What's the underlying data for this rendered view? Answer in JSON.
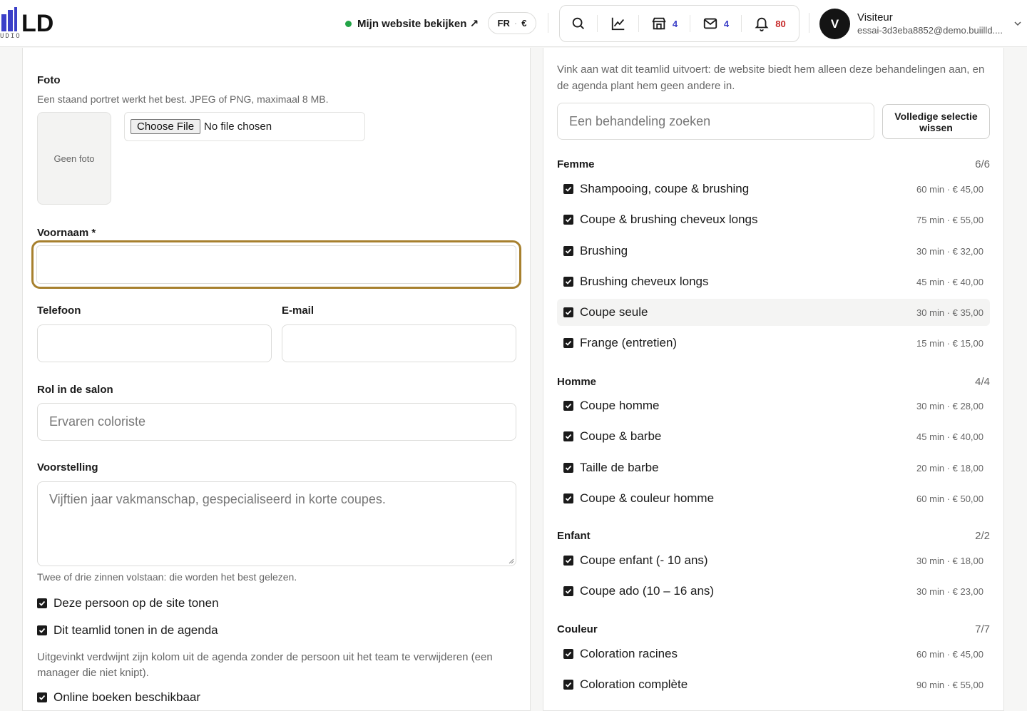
{
  "header": {
    "logo_text": "LD",
    "logo_sub": "UDIO",
    "view_site": "Mijn website bekijken ↗",
    "lang": "FR",
    "currency": "€",
    "counts": {
      "shop": "4",
      "mail": "4",
      "bell": "80"
    },
    "user": {
      "initial": "V",
      "name": "Visiteur",
      "email": "essai-3d3eba8852@demo.buiilld...."
    }
  },
  "form": {
    "photo_label": "Foto",
    "photo_hint": "Een staand portret werkt het best. JPEG of PNG, maximaal 8 MB.",
    "no_photo": "Geen foto",
    "file_button": "Choose File",
    "file_status": "No file chosen",
    "firstname_label": "Voornaam *",
    "firstname_value": "",
    "phone_label": "Telefoon",
    "email_label": "E-mail",
    "role_label": "Rol in de salon",
    "role_placeholder": "Ervaren coloriste",
    "bio_label": "Voorstelling",
    "bio_placeholder": "Vijftien jaar vakmanschap, gespecialiseerd in korte coupes.",
    "bio_hint": "Twee of drie zinnen volstaan: die worden het best gelezen.",
    "show_on_site": "Deze persoon op de site tonen",
    "show_in_agenda": "Dit teamlid tonen in de agenda",
    "agenda_hint": "Uitgevinkt verdwijnt zijn kolom uit de agenda zonder de persoon uit het team te verwijderen (een manager die niet knipt).",
    "online_booking": "Online boeken beschikbaar"
  },
  "services": {
    "intro": "Vink aan wat dit teamlid uitvoert: de website biedt hem alleen deze behandelingen aan, en de agenda plant hem geen andere in.",
    "search_placeholder": "Een behandeling zoeken",
    "clear_button": "Volledige selectie wissen",
    "categories": [
      {
        "name": "Femme",
        "count": "6/6",
        "items": [
          {
            "name": "Shampooing, coupe & brushing",
            "meta": "60 min · € 45,00"
          },
          {
            "name": "Coupe & brushing cheveux longs",
            "meta": "75 min · € 55,00"
          },
          {
            "name": "Brushing",
            "meta": "30 min · € 32,00"
          },
          {
            "name": "Brushing cheveux longs",
            "meta": "45 min · € 40,00"
          },
          {
            "name": "Coupe seule",
            "meta": "30 min · € 35,00"
          },
          {
            "name": "Frange (entretien)",
            "meta": "15 min · € 15,00"
          }
        ]
      },
      {
        "name": "Homme",
        "count": "4/4",
        "items": [
          {
            "name": "Coupe homme",
            "meta": "30 min · € 28,00"
          },
          {
            "name": "Coupe & barbe",
            "meta": "45 min · € 40,00"
          },
          {
            "name": "Taille de barbe",
            "meta": "20 min · € 18,00"
          },
          {
            "name": "Coupe & couleur homme",
            "meta": "60 min · € 50,00"
          }
        ]
      },
      {
        "name": "Enfant",
        "count": "2/2",
        "items": [
          {
            "name": "Coupe enfant (- 10 ans)",
            "meta": "30 min · € 18,00"
          },
          {
            "name": "Coupe ado (10 – 16 ans)",
            "meta": "30 min · € 23,00"
          }
        ]
      },
      {
        "name": "Couleur",
        "count": "7/7",
        "items": [
          {
            "name": "Coloration racines",
            "meta": "60 min · € 45,00"
          },
          {
            "name": "Coloration complète",
            "meta": "90 min · € 55,00"
          }
        ]
      }
    ]
  }
}
